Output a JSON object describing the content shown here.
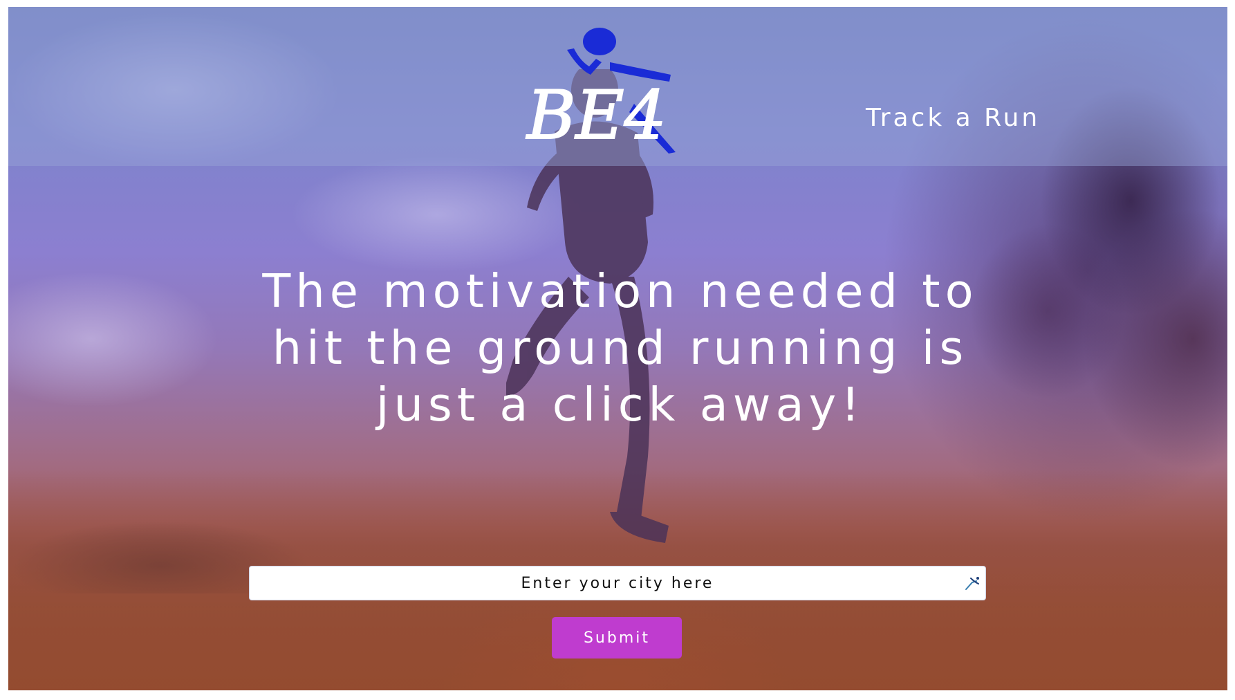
{
  "brand": {
    "logo_text": "BE4",
    "logo_icon": "runner-icon",
    "logo_color": "#1a2bd6"
  },
  "nav": {
    "track_run_label": "Track a Run"
  },
  "hero": {
    "headline": "The motivation needed to hit the ground running is just a click away!"
  },
  "search": {
    "placeholder": "Enter your city here",
    "value": "",
    "icon": "location-runner-icon"
  },
  "form": {
    "submit_label": "Submit",
    "submit_color": "#bf3ccf"
  },
  "colors": {
    "header_overlay": "#96a5d7",
    "text": "#ffffff"
  }
}
